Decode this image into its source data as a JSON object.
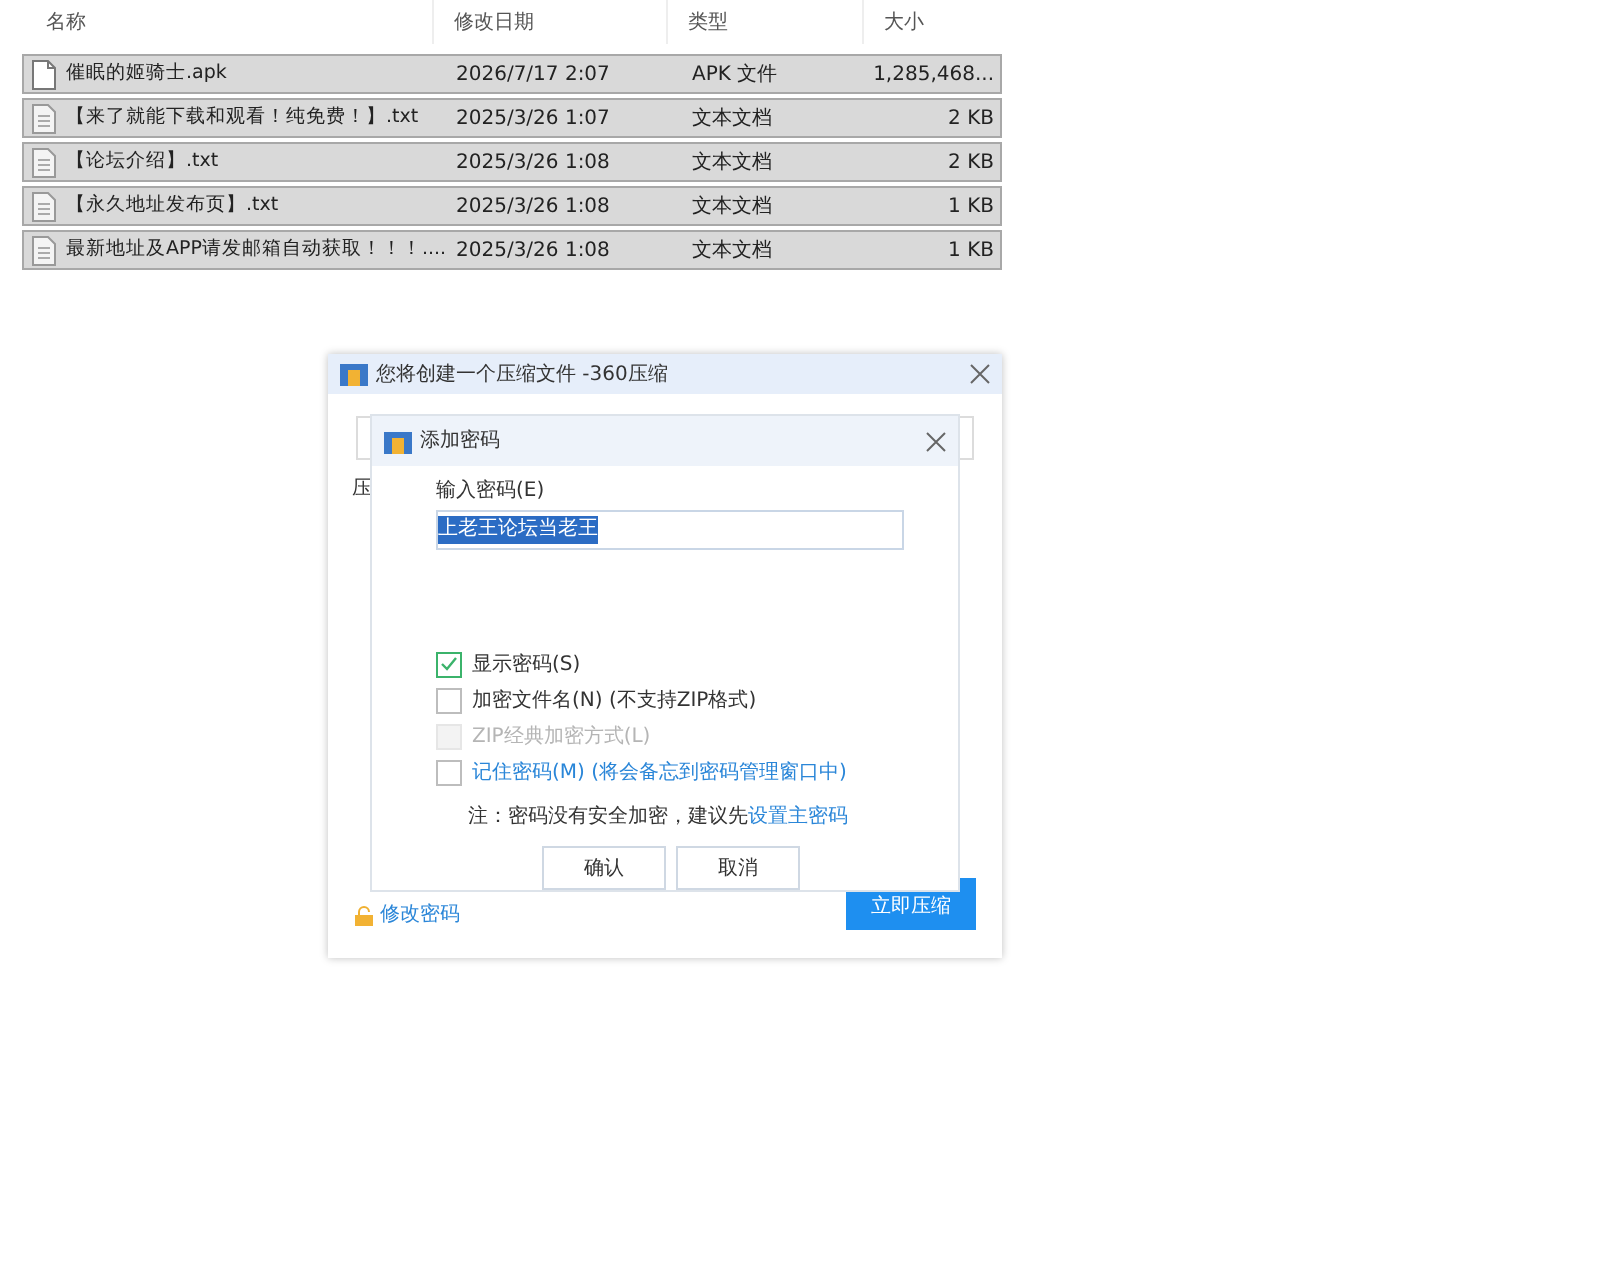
{
  "file_list": {
    "columns": [
      "名称",
      "修改日期",
      "类型",
      "大小"
    ],
    "rows": [
      {
        "kind": "apk",
        "selected": true,
        "name": "催眠的姬骑士.apk",
        "date": "2026/7/17 2:07",
        "type": "APK 文件",
        "size": "1,285,468..."
      },
      {
        "kind": "txt",
        "selected": true,
        "name": "【来了就能下载和观看！纯免费！】.txt",
        "date": "2025/3/26 1:07",
        "type": "文本文档",
        "size": "2 KB"
      },
      {
        "kind": "txt",
        "selected": true,
        "name": "【论坛介绍】.txt",
        "date": "2025/3/26 1:08",
        "type": "文本文档",
        "size": "2 KB"
      },
      {
        "kind": "txt",
        "selected": true,
        "name": "【永久地址发布页】.txt",
        "date": "2025/3/26 1:08",
        "type": "文本文档",
        "size": "1 KB"
      },
      {
        "kind": "txt",
        "selected": true,
        "name": "最新地址及APP请发邮箱自动获取！！！....",
        "date": "2025/3/26 1:08",
        "type": "文本文档",
        "size": "1 KB"
      }
    ]
  },
  "compress_dialog": {
    "title": "您将创建一个压缩文件 -360压缩",
    "label": "压",
    "change_password_link": "修改密码",
    "compress_button": "立即压缩"
  },
  "password_dialog": {
    "title": "添加密码",
    "field_label": "输入密码(E)",
    "password": "上老王论坛当老王",
    "options": [
      {
        "label": "显示密码(S)",
        "checked": true,
        "disabled": false,
        "kind": "plain"
      },
      {
        "label": "加密文件名(N) (不支持ZIP格式)",
        "checked": false,
        "disabled": false,
        "kind": "plain"
      },
      {
        "label": "ZIP经典加密方式(L)",
        "checked": false,
        "disabled": true,
        "kind": "plain"
      },
      {
        "label": "记住密码(M) (将会备忘到密码管理窗口中)",
        "checked": false,
        "disabled": false,
        "kind": "link"
      }
    ],
    "note": "注：密码没有安全加密，建议先",
    "note_link": "设置主密码",
    "buttons": [
      "确认",
      "取消"
    ]
  }
}
